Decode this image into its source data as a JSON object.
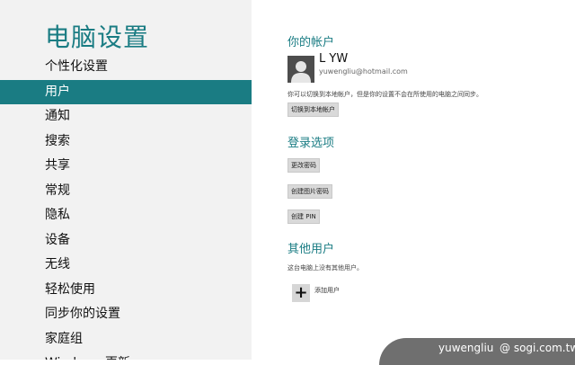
{
  "sidebar": {
    "title": "电脑设置",
    "items": [
      {
        "label": "个性化设置"
      },
      {
        "label": "用户"
      },
      {
        "label": "通知"
      },
      {
        "label": "搜索"
      },
      {
        "label": "共享"
      },
      {
        "label": "常规"
      },
      {
        "label": "隐私"
      },
      {
        "label": "设备"
      },
      {
        "label": "无线"
      },
      {
        "label": "轻松使用"
      },
      {
        "label": "同步你的设置"
      },
      {
        "label": "家庭组"
      },
      {
        "label": "Windows 更新"
      }
    ],
    "active_index": 1
  },
  "account": {
    "heading": "你的帐户",
    "name": "L YW",
    "email": "yuwengliu@hotmail.com",
    "info": "你可以切换到本地帐户，但是你的设置不会在所使用的电脑之间同步。",
    "switch_button": "切换到本地帐户"
  },
  "signin": {
    "heading": "登录选项",
    "change_password": "更改密码",
    "picture_password": "创建图片密码",
    "create_pin": "创建 PIN"
  },
  "other_users": {
    "heading": "其他用户",
    "info": "这台电脑上没有其他用户。",
    "add_icon": "+",
    "add_user": "添加用户"
  },
  "watermark": {
    "user": "yuwengliu",
    "site": "@ sogi.com.tw"
  },
  "colors": {
    "accent": "#1a7c83",
    "sidebar_bg": "#f2f2f2"
  }
}
